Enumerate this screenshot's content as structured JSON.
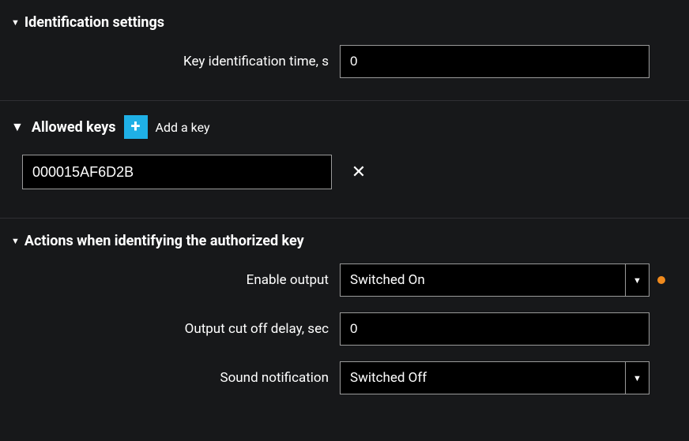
{
  "sections": {
    "identification": {
      "title": "Identification settings",
      "fields": {
        "key_id_time_label": "Key identification time, s",
        "key_id_time_value": "0"
      }
    },
    "allowed_keys": {
      "title": "Allowed keys",
      "add_label": "Add a key",
      "keys": [
        {
          "value": "000015AF6D2B"
        }
      ]
    },
    "actions": {
      "title": "Actions when identifying the authorized key",
      "fields": {
        "enable_output_label": "Enable output",
        "enable_output_value": "Switched On",
        "enable_output_modified": true,
        "cutoff_label": "Output cut off delay, sec",
        "cutoff_value": "0",
        "sound_label": "Sound notification",
        "sound_value": "Switched Off"
      }
    }
  },
  "icons": {
    "plus": "＋",
    "close": "✕",
    "caret_down": "▼"
  }
}
